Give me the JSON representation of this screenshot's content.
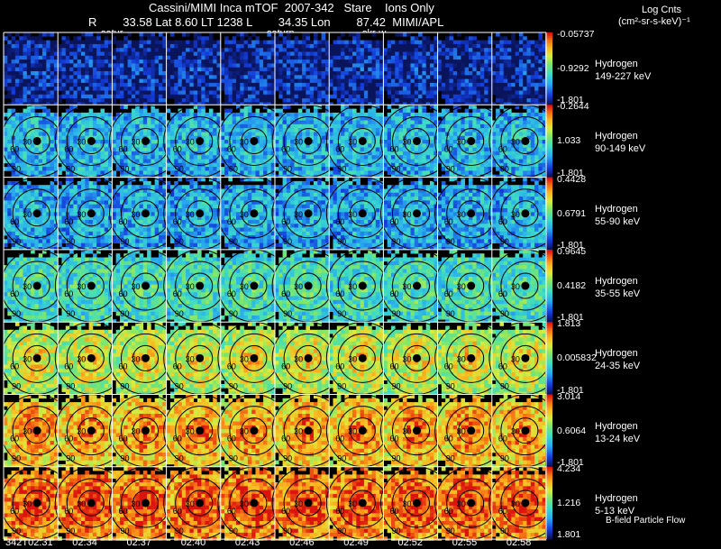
{
  "header": {
    "title": "Cassini/MIMI Inca mTOF  2007-342   Stare    Ions Only",
    "info_line": "R        33.58 Lat 8.60 LT 1238 L        34.35 Lon        87.42  MIMI/APL",
    "overlay_labels": [
      "satur",
      "saturn",
      "skr-w"
    ],
    "units_title": "Log Cnts",
    "units_sub": "(cm²-sr-s-keV)⁻¹"
  },
  "rows": [
    {
      "species": "Hydrogen",
      "energy": "149-227 keV",
      "cb_max": "-0.05737",
      "cb_mid": "-0.9292",
      "cb_min": "-1.801",
      "level": 0.05,
      "ring_labels": []
    },
    {
      "species": "Hydrogen",
      "energy": "90-149 keV",
      "cb_max": "-0.2644",
      "cb_mid": "1.033",
      "cb_min": "-1.801",
      "level": 0.3,
      "ring_labels": [
        "30",
        "60",
        "90"
      ]
    },
    {
      "species": "Hydrogen",
      "energy": "55-90 keV",
      "cb_max": "0.4428",
      "cb_mid": "0.6791",
      "cb_min": "-1.801",
      "level": 0.28,
      "ring_labels": [
        "30",
        "60",
        "90"
      ]
    },
    {
      "species": "Hydrogen",
      "energy": "35-55 keV",
      "cb_max": "0.9645",
      "cb_mid": "0.4182",
      "cb_min": "-1.801",
      "level": 0.42,
      "ring_labels": [
        "30",
        "60",
        "90"
      ]
    },
    {
      "species": "Hydrogen",
      "energy": "24-35 keV",
      "cb_max": "1.813",
      "cb_mid": "0.005832",
      "cb_min": "-1.801",
      "level": 0.62,
      "ring_labels": [
        "30",
        "60",
        "90"
      ]
    },
    {
      "species": "Hydrogen",
      "energy": "13-24 keV",
      "cb_max": "3.014",
      "cb_mid": "0.6064",
      "cb_min": "-1.801",
      "level": 0.76,
      "ring_labels": [
        "30",
        "60",
        "90"
      ]
    },
    {
      "species": "Hydrogen",
      "energy": "5-13 keV",
      "cb_max": "4.234",
      "cb_mid": "1.216",
      "cb_min": "1.801",
      "level": 0.86,
      "ring_labels": [
        "30",
        "60",
        "90"
      ]
    }
  ],
  "times": [
    "342T02:31",
    "02:34",
    "02:37",
    "02:40",
    "02:43",
    "02:46",
    "02:49",
    "02:52",
    "02:55",
    "02:58"
  ],
  "footer_note": "B-field Particle Flow",
  "colors": {
    "background": "#000000",
    "grid_line": "#ffffff"
  }
}
